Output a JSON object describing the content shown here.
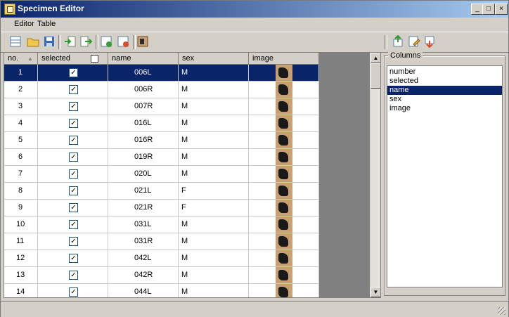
{
  "window": {
    "title": "Specimen Editor"
  },
  "title_buttons": {
    "minimize": "_",
    "maximize": "□",
    "close": "×"
  },
  "menu": {
    "items": [
      "Editor",
      "Table"
    ]
  },
  "grid": {
    "headers": [
      "no.",
      "selected",
      "name",
      "sex",
      "image"
    ],
    "rows": [
      {
        "no": "1",
        "name": "006L",
        "sex": "M",
        "selected": true
      },
      {
        "no": "2",
        "name": "006R",
        "sex": "M",
        "selected": true
      },
      {
        "no": "3",
        "name": "007R",
        "sex": "M",
        "selected": true
      },
      {
        "no": "4",
        "name": "016L",
        "sex": "M",
        "selected": true
      },
      {
        "no": "5",
        "name": "016R",
        "sex": "M",
        "selected": true
      },
      {
        "no": "6",
        "name": "019R",
        "sex": "M",
        "selected": true
      },
      {
        "no": "7",
        "name": "020L",
        "sex": "M",
        "selected": true
      },
      {
        "no": "8",
        "name": "021L",
        "sex": "F",
        "selected": true
      },
      {
        "no": "9",
        "name": "021R",
        "sex": "F",
        "selected": true
      },
      {
        "no": "10",
        "name": "031L",
        "sex": "M",
        "selected": true
      },
      {
        "no": "11",
        "name": "031R",
        "sex": "M",
        "selected": true
      },
      {
        "no": "12",
        "name": "042L",
        "sex": "M",
        "selected": true
      },
      {
        "no": "13",
        "name": "042R",
        "sex": "M",
        "selected": true
      },
      {
        "no": "14",
        "name": "044L",
        "sex": "M",
        "selected": true
      }
    ],
    "selected_row_index": 0
  },
  "columns_panel": {
    "label": "Columns",
    "items": [
      "number",
      "selected",
      "name",
      "sex",
      "image"
    ],
    "selected_index": 2
  },
  "colors": {
    "selection": "#0a246a",
    "title_gradient_start": "#0a246a",
    "title_gradient_end": "#a6caf0"
  }
}
